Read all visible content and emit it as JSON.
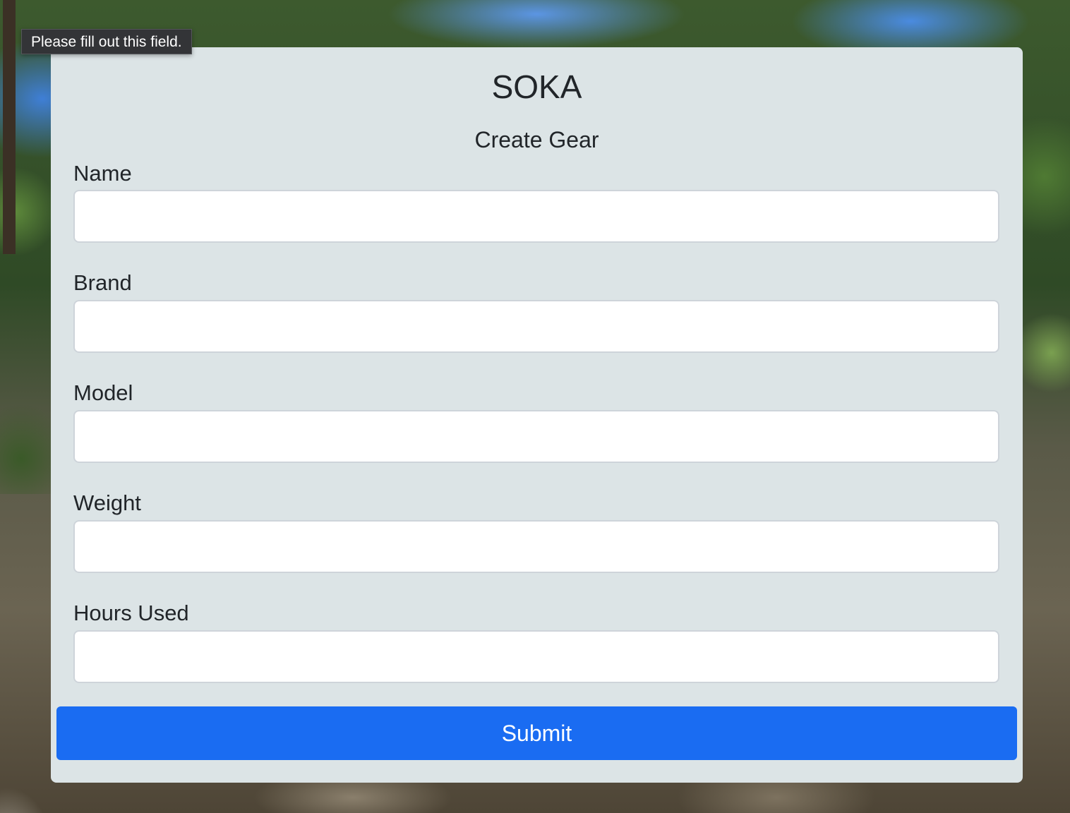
{
  "app": {
    "title": "SOKA",
    "subtitle": "Create Gear"
  },
  "tooltip": {
    "text": "Please fill out this field."
  },
  "form": {
    "fields": [
      {
        "label": "Name",
        "value": "",
        "placeholder": ""
      },
      {
        "label": "Brand",
        "value": "",
        "placeholder": ""
      },
      {
        "label": "Model",
        "value": "",
        "placeholder": ""
      },
      {
        "label": "Weight",
        "value": "",
        "placeholder": ""
      },
      {
        "label": "Hours Used",
        "value": "",
        "placeholder": ""
      }
    ],
    "submit_label": "Submit"
  },
  "colors": {
    "card_background": "#dce4e6",
    "submit_button": "#1a6cf2",
    "text": "#212529",
    "tooltip_background": "#333437"
  }
}
